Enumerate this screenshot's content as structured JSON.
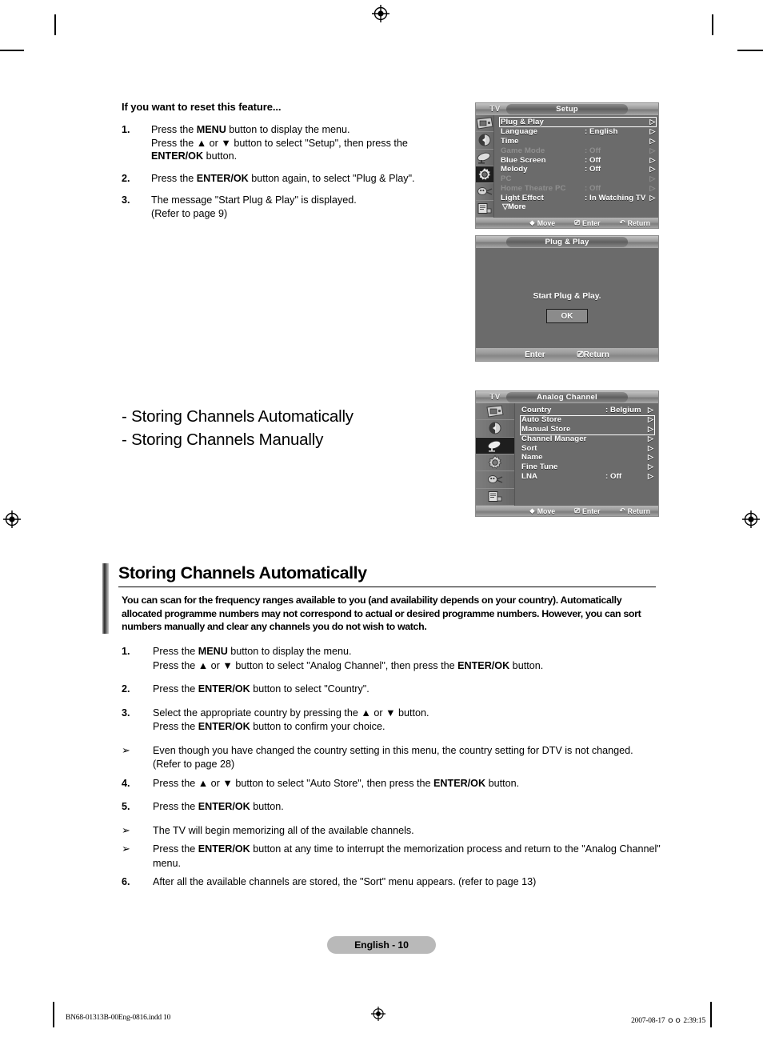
{
  "doc": {
    "page_label": "English - 10",
    "footer_left": "BN68-01313B-00Eng-0816.indd   10",
    "footer_right": "2007-08-17   ｏｏ 2:39:15"
  },
  "reset_section": {
    "title": "If you want to reset this feature...",
    "steps": [
      {
        "num": "1.",
        "html": "Press the <b>MENU</b> button to display the menu.<br>Press the ▲ or ▼ button to select \"Setup\", then press the <b>ENTER/OK</b> button."
      },
      {
        "num": "2.",
        "html": "Press the <b>ENTER/OK</b> button again, to select \"Plug &amp; Play\"."
      },
      {
        "num": "3.",
        "html": "The message \"Start Plug &amp; Play\" is displayed.<br>(Refer to page 9)"
      }
    ]
  },
  "storing_list": {
    "line1": "- Storing Channels Automatically",
    "line2": "- Storing Channels Manually"
  },
  "main_section": {
    "heading": "Storing Channels Automatically",
    "intro": "You can scan for the frequency ranges available to you (and availability depends on your country). Automatically allocated programme numbers may not correspond to actual or desired programme numbers. However, you can sort numbers manually and clear any channels you do not wish to watch.",
    "steps": [
      {
        "num": "1.",
        "type": "num",
        "html": "Press the <b>MENU</b> button to display the menu.<br>Press the ▲ or ▼ button to select \"Analog Channel\", then press the <b>ENTER/OK</b> button."
      },
      {
        "num": "2.",
        "type": "num",
        "html": "Press the <b>ENTER/OK</b> button to select \"Country\"."
      },
      {
        "num": "3.",
        "type": "num",
        "html": "Select the appropriate country by pressing the ▲ or ▼ button.<br>Press the <b>ENTER/OK</b> button to confirm your choice."
      },
      {
        "num": "➢",
        "type": "note",
        "html": "Even though you have changed the country setting in this menu, the country setting for DTV is not changed. (Refer to page 28)"
      },
      {
        "num": "4.",
        "type": "num",
        "html": "Press the ▲ or ▼ button to select \"Auto Store\", then press the <b>ENTER/OK</b> button."
      },
      {
        "num": "5.",
        "type": "num",
        "html": "Press the <b>ENTER/OK</b> button."
      },
      {
        "num": "➢",
        "type": "note",
        "html": "The TV will begin memorizing all of the available channels."
      },
      {
        "num": "➢",
        "type": "note",
        "html": "Press the <b>ENTER/OK</b> button at any time to interrupt the memorization process and return to the \"Analog Channel\" menu."
      },
      {
        "num": "6.",
        "type": "num",
        "html": "After all the available channels are stored, the \"Sort\" menu appears. (refer to page 13)"
      }
    ]
  },
  "osd_setup": {
    "tv_label": "TV",
    "title": "Setup",
    "selected_sidebar_index": 3,
    "sidebar_icons": [
      "picture-icon",
      "sound-icon",
      "channel-dish-icon",
      "setup-gear-icon",
      "input-plug-icon",
      "pc-setup-icon"
    ],
    "rows": [
      {
        "label": "Plug & Play",
        "value": "",
        "arrow": "▷",
        "dim": false
      },
      {
        "label": "Language",
        "value": ": English",
        "arrow": "▷",
        "dim": false
      },
      {
        "label": "Time",
        "value": "",
        "arrow": "▷",
        "dim": false
      },
      {
        "label": "Game Mode",
        "value": ": Off",
        "arrow": "▷",
        "dim": true
      },
      {
        "label": "Blue Screen",
        "value": ": Off",
        "arrow": "▷",
        "dim": false
      },
      {
        "label": "Melody",
        "value": ": Off",
        "arrow": "▷",
        "dim": false
      },
      {
        "label": "PC",
        "value": "",
        "arrow": "▷",
        "dim": true
      },
      {
        "label": "Home Theatre PC",
        "value": ": Off",
        "arrow": "▷",
        "dim": true
      },
      {
        "label": "Light Effect",
        "value": ": In Watching TV",
        "arrow": "▷",
        "dim": false
      }
    ],
    "more_label": "▽More",
    "footer": {
      "move": "Move",
      "enter": "Enter",
      "return": "Return"
    }
  },
  "osd_plugplay": {
    "title": "Plug & Play",
    "message": "Start Plug & Play.",
    "ok_label": "OK",
    "footer": {
      "enter": "Enter",
      "return": "Return"
    }
  },
  "osd_analog": {
    "tv_label": "TV",
    "title": "Analog Channel",
    "selected_sidebar_index": 2,
    "sidebar_icons": [
      "picture-icon",
      "sound-icon",
      "channel-dish-icon",
      "setup-gear-icon",
      "input-plug-icon",
      "pc-setup-icon"
    ],
    "rows": [
      {
        "label": "Country",
        "value": ": Belgium",
        "arrow": "▷",
        "dim": false
      },
      {
        "label": "Auto Store",
        "value": "",
        "arrow": "▷",
        "dim": false
      },
      {
        "label": "Manual Store",
        "value": "",
        "arrow": "▷",
        "dim": false
      },
      {
        "label": "Channel Manager",
        "value": "",
        "arrow": "▷",
        "dim": false
      },
      {
        "label": "Sort",
        "value": "",
        "arrow": "▷",
        "dim": false
      },
      {
        "label": "Name",
        "value": "",
        "arrow": "▷",
        "dim": false
      },
      {
        "label": "Fine Tune",
        "value": "",
        "arrow": "▷",
        "dim": false
      },
      {
        "label": "LNA",
        "value": ": Off",
        "arrow": "▷",
        "dim": false
      }
    ],
    "footer": {
      "move": "Move",
      "enter": "Enter",
      "return": "Return"
    }
  }
}
